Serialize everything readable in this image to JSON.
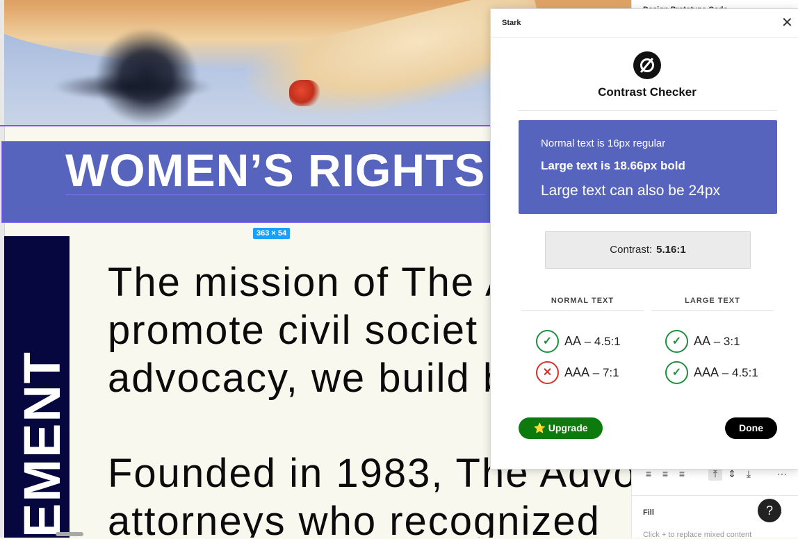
{
  "canvas": {
    "banner_heading": "WOMEN’S RIGHTS",
    "selection_size": "363 × 54",
    "side_label": "EMENT",
    "paragraph1": [
      "The mission of The A",
      "promote  civil  societ",
      "advocacy, we build b"
    ],
    "paragraph2": [
      "Founded  in  1983,  The  Advo",
      "attorneys  who  recognized"
    ]
  },
  "properties_panel": {
    "tabs": "Design   Prototype   Code",
    "fill_label": "Fill",
    "fill_add": "+",
    "fill_hint": "Click + to replace mixed content",
    "help_label": "?"
  },
  "plugin": {
    "window_title": "Stark",
    "heading": "Contrast Checker",
    "preview": {
      "line1": "Normal text is 16px regular",
      "line2": "Large text is 18.66px bold",
      "line3": "Large text can also be 24px"
    },
    "contrast_label": "Contrast:",
    "contrast_value": "5.16:1",
    "columns": {
      "normal": "NORMAL TEXT",
      "large": "LARGE TEXT"
    },
    "normal_results": [
      {
        "level": "AA",
        "ratio": "– 4.5:1",
        "status": "pass"
      },
      {
        "level": "AAA",
        "ratio": "– 7:1",
        "status": "fail"
      }
    ],
    "large_results": [
      {
        "level": "AA",
        "ratio": "– 3:1",
        "status": "pass"
      },
      {
        "level": "AAA",
        "ratio": "– 4.5:1",
        "status": "pass"
      }
    ],
    "upgrade_label": "⭐ Upgrade",
    "done_label": "Done"
  },
  "colors": {
    "banner": "#5664be",
    "side_bar": "#07073f",
    "pass": "#1e8e3e",
    "fail": "#d93025",
    "upgrade": "#0d7a0d"
  }
}
